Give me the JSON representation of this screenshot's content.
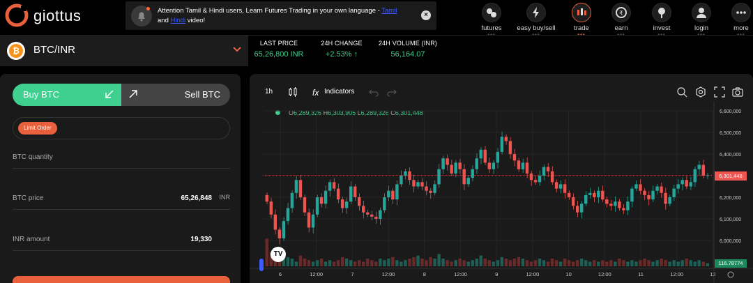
{
  "brand": {
    "name": "giottus"
  },
  "notice": {
    "text_pre": "Attention Tamil & Hindi users, Learn Futures Trading in your own language - ",
    "link1": "Tamil",
    "text_mid": " and ",
    "link2": "Hindi",
    "text_post": " video!",
    "close_icon": "close-icon"
  },
  "nav": [
    {
      "label": "futures",
      "icon": "futures-icon"
    },
    {
      "label": "easy buy/sell",
      "icon": "lightning-icon"
    },
    {
      "label": "trade",
      "icon": "candles-icon",
      "active": true
    },
    {
      "label": "earn",
      "icon": "rupee-coin-icon"
    },
    {
      "label": "invest",
      "icon": "plant-icon"
    },
    {
      "label": "login",
      "icon": "user-icon"
    },
    {
      "label": "more",
      "icon": "dots-icon"
    }
  ],
  "pair": {
    "name": "BTC/INR",
    "coin_symbol": "₿"
  },
  "stats": [
    {
      "label": "LAST PRICE",
      "value": "65,26,800 INR"
    },
    {
      "label": "24H CHANGE",
      "value": "+2.53% ↑"
    },
    {
      "label": "24H VOLUME (INR)",
      "value": "56,164.07"
    }
  ],
  "order": {
    "buy_label": "Buy BTC",
    "sell_label": "Sell BTC",
    "order_type": "Limit Order",
    "fields": [
      {
        "label": "BTC quantity",
        "value": "",
        "unit": ""
      },
      {
        "label": "BTC price",
        "value": "65,26,848",
        "unit": "INR"
      },
      {
        "label": "INR amount",
        "value": "19,330",
        "unit": ""
      }
    ]
  },
  "toolbar": {
    "interval": "1h",
    "indicators": "Indicators"
  },
  "ohlc": {
    "o_label": "O",
    "o": "6,289,326",
    "h_label": "H",
    "h": "6,303,905",
    "l_label": "L",
    "l": "6,289,326",
    "c_label": "C",
    "c": "6,301,448"
  },
  "price_tag": "6,301,448",
  "volume_tag": "116.78774",
  "tv_logo": "TV",
  "colors": {
    "up": "#26a69a",
    "down": "#ef5350",
    "accent": "#e8603c",
    "green_text": "#3fcf8e"
  },
  "chart_data": {
    "type": "candlestick",
    "y_ticks": [
      "6,600,000",
      "6,500,000",
      "6,400,000",
      "6,300,000",
      "6,200,000",
      "6,100,000",
      "6,000,000"
    ],
    "ylim": [
      6000000,
      6600000
    ],
    "x_ticks": [
      "6",
      "12:00",
      "7",
      "12:00",
      "8",
      "12:00",
      "9",
      "12:00",
      "10",
      "12:00",
      "11",
      "12:00",
      "12"
    ],
    "last_close": 6301448,
    "closes": [
      6180000,
      6120000,
      6050000,
      6010000,
      6090000,
      6150000,
      6220000,
      6280000,
      6200000,
      6130000,
      6060000,
      6120000,
      6200000,
      6170000,
      6230000,
      6270000,
      6240000,
      6190000,
      6150000,
      6180000,
      6250000,
      6200000,
      6160000,
      6130000,
      6120000,
      6110000,
      6100000,
      6140000,
      6200000,
      6230000,
      6190000,
      6260000,
      6300000,
      6320000,
      6280000,
      6250000,
      6270000,
      6250000,
      6230000,
      6220000,
      6260000,
      6330000,
      6380000,
      6350000,
      6310000,
      6360000,
      6330000,
      6260000,
      6290000,
      6330000,
      6380000,
      6420000,
      6360000,
      6330000,
      6360000,
      6410000,
      6480000,
      6460000,
      6400000,
      6370000,
      6330000,
      6360000,
      6310000,
      6280000,
      6270000,
      6300000,
      6340000,
      6320000,
      6270000,
      6240000,
      6260000,
      6220000,
      6200000,
      6160000,
      6130000,
      6170000,
      6210000,
      6220000,
      6200000,
      6230000,
      6190000,
      6170000,
      6160000,
      6180000,
      6150000,
      6140000,
      6180000,
      6240000,
      6260000,
      6230000,
      6210000,
      6190000,
      6230000,
      6250000,
      6220000,
      6170000,
      6200000,
      6240000,
      6260000,
      6280000,
      6250000,
      6270000,
      6330000,
      6350000,
      6300000,
      6301448
    ],
    "volumes": [
      18,
      9,
      6,
      4,
      5,
      6,
      5,
      3,
      7,
      5,
      4,
      3,
      4,
      5,
      3,
      4,
      3,
      4,
      6,
      5,
      4,
      3,
      4,
      3,
      5,
      4,
      3,
      5,
      4,
      5,
      6,
      4,
      3,
      4,
      5,
      6,
      7,
      5,
      4,
      6,
      5,
      8,
      5,
      4,
      3,
      4,
      5,
      4,
      3,
      4,
      5,
      7,
      5,
      4,
      3,
      4,
      6,
      5,
      4,
      5,
      6,
      5,
      4,
      3,
      4,
      5,
      4,
      3,
      5,
      4,
      3,
      5,
      4,
      3,
      4,
      5,
      4,
      3,
      4,
      3,
      4,
      3,
      4,
      3,
      5,
      4,
      3,
      4,
      3,
      4,
      5,
      4,
      3,
      4,
      5,
      4,
      3,
      4,
      3,
      4,
      5,
      4,
      3,
      4,
      3,
      2
    ]
  }
}
